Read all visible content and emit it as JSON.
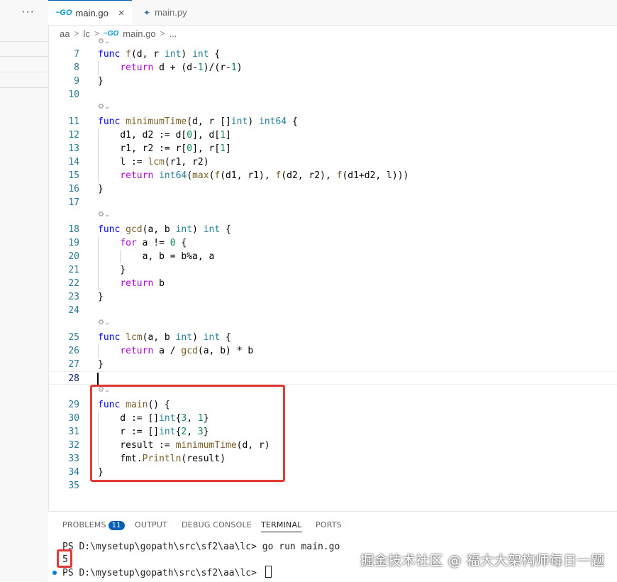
{
  "sidebar": {
    "more_label": "···"
  },
  "tabs": [
    {
      "label": "main.go",
      "icon": "go-file-icon",
      "active": true
    },
    {
      "label": "main.py",
      "icon": "python-file-icon",
      "active": false
    }
  ],
  "breadcrumb": [
    "aa",
    "lc",
    "main.go",
    "..."
  ],
  "editor": {
    "code_lens_glyph": "⚙⌄",
    "lines": [
      {
        "n": "7",
        "text": "func f(d, r int) int {"
      },
      {
        "n": "8",
        "text": "    return d + (d-1)/(r-1)"
      },
      {
        "n": "9",
        "text": "}"
      },
      {
        "n": "10",
        "text": ""
      },
      {
        "n": "11",
        "text": "func minimumTime(d, r []int) int64 {"
      },
      {
        "n": "12",
        "text": "    d1, d2 := d[0], d[1]"
      },
      {
        "n": "13",
        "text": "    r1, r2 := r[0], r[1]"
      },
      {
        "n": "14",
        "text": "    l := lcm(r1, r2)"
      },
      {
        "n": "15",
        "text": "    return int64(max(f(d1, r1), f(d2, r2), f(d1+d2, l)))"
      },
      {
        "n": "16",
        "text": "}"
      },
      {
        "n": "17",
        "text": ""
      },
      {
        "n": "18",
        "text": "func gcd(a, b int) int {"
      },
      {
        "n": "19",
        "text": "    for a != 0 {"
      },
      {
        "n": "20",
        "text": "        a, b = b%a, a"
      },
      {
        "n": "21",
        "text": "    }"
      },
      {
        "n": "22",
        "text": "    return b"
      },
      {
        "n": "23",
        "text": "}"
      },
      {
        "n": "24",
        "text": ""
      },
      {
        "n": "25",
        "text": "func lcm(a, b int) int {"
      },
      {
        "n": "26",
        "text": "    return a / gcd(a, b) * b"
      },
      {
        "n": "27",
        "text": "}"
      },
      {
        "n": "28",
        "text": ""
      },
      {
        "n": "29",
        "text": "func main() {"
      },
      {
        "n": "30",
        "text": "    d := []int{3, 1}"
      },
      {
        "n": "31",
        "text": "    r := []int{2, 3}"
      },
      {
        "n": "32",
        "text": "    result := minimumTime(d, r)"
      },
      {
        "n": "33",
        "text": "    fmt.Println(result)"
      },
      {
        "n": "34",
        "text": "}"
      },
      {
        "n": "35",
        "text": ""
      }
    ]
  },
  "panel": {
    "tabs": [
      {
        "label": "PROBLEMS",
        "badge": "11"
      },
      {
        "label": "OUTPUT"
      },
      {
        "label": "DEBUG CONSOLE"
      },
      {
        "label": "TERMINAL",
        "active": true
      },
      {
        "label": "PORTS"
      }
    ],
    "terminal": {
      "line1": "PS D:\\mysetup\\gopath\\src\\sf2\\aa\\lc> go run main.go",
      "output": "5",
      "line3": "PS D:\\mysetup\\gopath\\src\\sf2\\aa\\lc> "
    }
  },
  "watermark": "掘金技术社区 @ 福大大架构师每日一题",
  "colors": {
    "highlight_box": "#e53935",
    "accent": "#005fb8",
    "keyword": "#0000ff"
  }
}
